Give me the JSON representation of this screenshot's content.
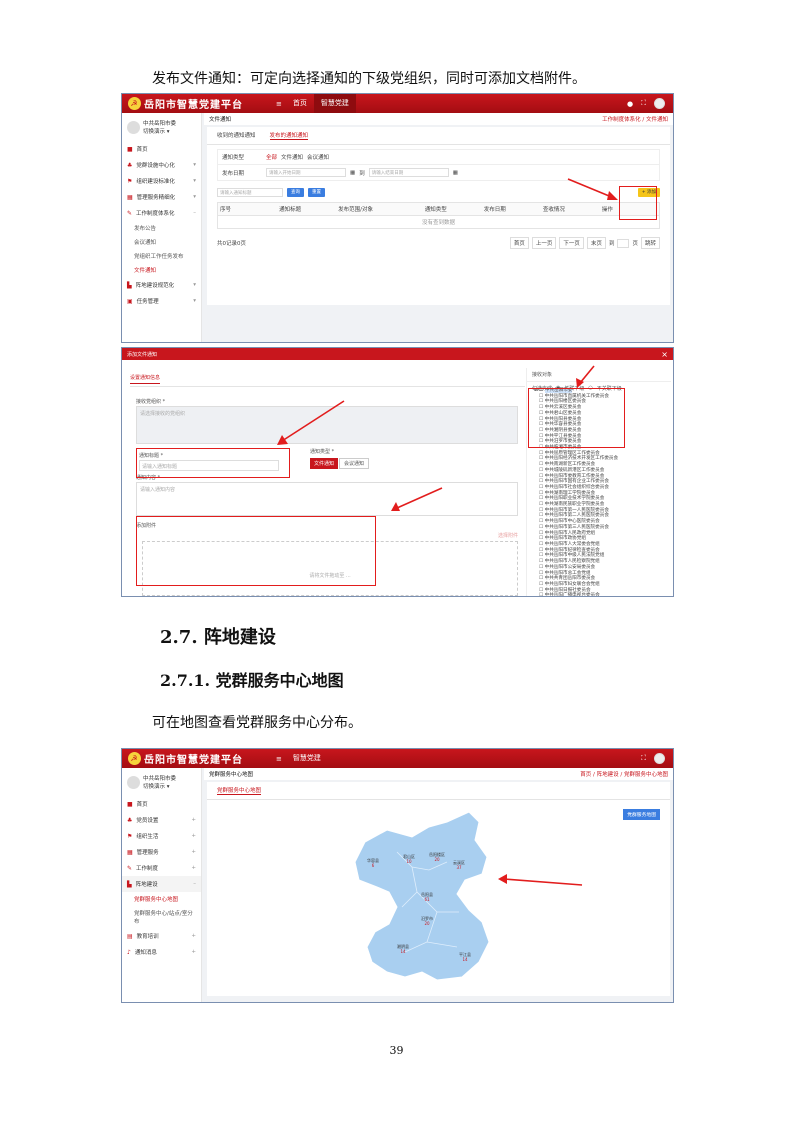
{
  "intro_text": "发布文件通知：可定向选择通知的下级党组织，同时可添加文档附件。",
  "app": {
    "title": "岳阳市智慧党建平台",
    "menu_icon": "≡",
    "nav": [
      "首页",
      "智慧党建"
    ],
    "header_icons": [
      "bell-icon",
      "fullscreen-icon"
    ],
    "accent": "#c8161d"
  },
  "shot1": {
    "user_name": "中共岳阳市委",
    "user_role": "切换演示 ▾",
    "menu": [
      {
        "label": "首页",
        "icon": "home-icon"
      },
      {
        "label": "党群设施中心化",
        "icon": "org-icon"
      },
      {
        "label": "组织建设标准化",
        "icon": "flag-icon"
      },
      {
        "label": "管理服务精细化",
        "icon": "grid-icon"
      },
      {
        "label": "工作制度体系化",
        "icon": "pen-icon"
      }
    ],
    "submenu": [
      "发布公告",
      "会议通知",
      "党组织工作任务发布",
      "文件通知"
    ],
    "menu_after": [
      {
        "label": "阵地建设规范化",
        "icon": "building-icon"
      },
      {
        "label": "任务管理",
        "icon": "task-icon"
      }
    ],
    "crumb_left": "文件通知",
    "crumb_right": "工作制度体系化 / 文件通知",
    "tabs": [
      "收到的通知通知",
      "发布的通知通知"
    ],
    "filter_label": "通知类型",
    "filter_options": [
      "全部",
      "文件通知",
      "会议通知"
    ],
    "date_label": "发布日期",
    "date_start_placeholder": "请输入开始日期",
    "date_to": "到",
    "date_end_placeholder": "请输入结束日期",
    "search_placeholder": "请输入通知标题",
    "search_btn": "查询",
    "reset_btn": "重置",
    "add_btn": "+ 添加",
    "columns": [
      "序号",
      "通知标题",
      "发布范围/对象",
      "",
      "通知类型",
      "发布日期",
      "查收情况",
      "操作"
    ],
    "empty_text": "没有查到数据",
    "total_text": "共0记录0页",
    "pager": [
      "首页",
      "上一页",
      "下一页",
      "末页",
      "到",
      "页",
      "跳转"
    ]
  },
  "dialog": {
    "title": "添加文件通知",
    "tab": "设置通知信息",
    "org_label": "接收党组织 *",
    "org_placeholder": "请选择接收的党组织",
    "title_label": "通知标题 *",
    "title_placeholder": "请输入通知标题",
    "type_label": "通知类型 *",
    "type_active": "文件通知",
    "type_other": "会议通知",
    "content_label": "通知内容 *",
    "content_placeholder": "请输入通知内容",
    "attach_label": "添加附件",
    "attach_side": "选择附件",
    "attach_hint": "请将文件拖动至 ...",
    "tree_header": "接收对象",
    "tree_mode_label": "勾选方式",
    "tree_mode_options": [
      "关联下级",
      "不关联下级"
    ],
    "tree_items": [
      "中共岳阳市委",
      "中共岳阳市直属机关工作委员会",
      "中共岳阳楼区委员会",
      "中共云溪区委员会",
      "中共君山区委员会",
      "中共岳阳县委员会",
      "中共华容县委员会",
      "中共湘阴县委员会",
      "中共平江县委员会",
      "中共汨罗市委员会",
      "中共临湘市委员会",
      "中共屈原管理区工作委员会",
      "中共岳阳经济技术开发区工作委员会",
      "中共南湖新区工作委员会",
      "中共城陵矶新港区工作委员会",
      "中共岳阳市委教育工作委员会",
      "中共岳阳市国有企业工作委员会",
      "中共岳阳市社会组织综合委员会",
      "中共湖南理工学院委员会",
      "中共岳阳职业技术学院委员会",
      "中共湖南民族职业学院委员会",
      "中共岳阳市第一人民医院委员会",
      "中共岳阳市第二人民医院委员会",
      "中共岳阳市中心医院委员会",
      "中共岳阳市第三人民医院委员会",
      "中共岳阳市人民政府党组",
      "中共岳阳市政协党组",
      "中共岳阳市人大常委会党组",
      "中共岳阳市纪律检查委员会",
      "中共岳阳市中级人民法院党组",
      "中共岳阳市人民检察院党组",
      "中共岳阳市公安局委员会",
      "中共岳阳市总工会党组",
      "中共共青团岳阳市委员会",
      "中共岳阳市妇女联合会党组",
      "中共岳阳日报社委员会",
      "中共岳阳广播电视台委员会",
      "中共岳阳市交通运输局委员会",
      "中共岳阳市住房和城乡建设局委员会",
      "中共岳阳市水务局委员会",
      "中共岳阳市农业农村局委员会",
      "中共岳阳市卫生健康委员会",
      "中共岳阳市教育体育局委员会",
      "中共岳阳市财政局党组"
    ]
  },
  "section_h2": "2.7.  阵地建设",
  "section_h3": "2.7.1.  党群服务中心地图",
  "para_text": "可在地图查看党群服务中心分布。",
  "shot2": {
    "user_name": "中共岳阳市委",
    "user_role": "切换演示 ▾",
    "menu": [
      {
        "label": "首页",
        "icon": "home-icon"
      },
      {
        "label": "党员设置",
        "icon": "org-icon"
      },
      {
        "label": "组织生活",
        "icon": "flag-icon"
      },
      {
        "label": "管理服务",
        "icon": "grid-icon"
      },
      {
        "label": "工作制度",
        "icon": "pen-icon"
      },
      {
        "label": "阵地建设",
        "icon": "building-icon"
      }
    ],
    "submenu": [
      "党群服务中心地图",
      "党群服务中心/站点/室分布"
    ],
    "menu_after": [
      {
        "label": "教育培训",
        "icon": "book-icon"
      },
      {
        "label": "通知消息",
        "icon": "bell-icon"
      }
    ],
    "crumb_left": "党群服务中心地图",
    "crumb_right": "首页 / 阵地建设 / 党群服务中心地图",
    "tab": "党群服务中心地图",
    "list_btn": "党群服务地图",
    "regions": [
      {
        "name": "华容县",
        "count": "6"
      },
      {
        "name": "君山区",
        "count": "10"
      },
      {
        "name": "岳阳楼区",
        "count": "20"
      },
      {
        "name": "云溪区",
        "count": "37"
      },
      {
        "name": "岳阳县",
        "count": "61"
      },
      {
        "name": "汨罗市",
        "count": "20"
      },
      {
        "name": "湘阴县",
        "count": "14"
      },
      {
        "name": "平江县",
        "count": "14"
      }
    ]
  },
  "page_number": "39"
}
